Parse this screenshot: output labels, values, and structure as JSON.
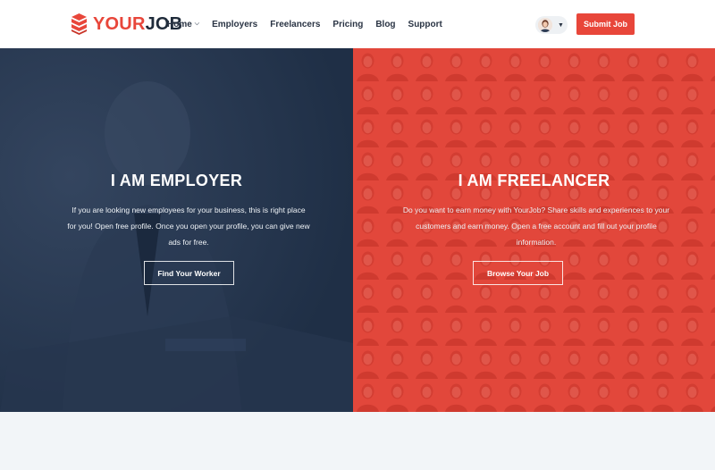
{
  "brand": {
    "part_a": "YOUR",
    "part_b": "JOB",
    "accent_color": "#e8463a",
    "dark_color": "#1f2b3a"
  },
  "nav": {
    "items": [
      {
        "label": "Home",
        "has_dropdown": true
      },
      {
        "label": "Employers"
      },
      {
        "label": "Freelancers"
      },
      {
        "label": "Pricing"
      },
      {
        "label": "Blog"
      },
      {
        "label": "Support"
      }
    ],
    "caret_icon": "chevron-down-icon"
  },
  "user_menu": {
    "avatar_icon": "user-avatar",
    "caret_icon": "caret-down-icon"
  },
  "header": {
    "submit_label": "Submit Job"
  },
  "employer": {
    "title": "I AM EMPLOYER",
    "text": "If you are looking new employees for your business, this is right place for you! Open free profile. Once you open your profile, you can give new ads for free.",
    "button_label": "Find Your Worker",
    "bg_color": "#1f2f46"
  },
  "freelancer": {
    "title": "I AM FREELANCER",
    "text": "Do you want to earn money with YourJob? Share skills and experiences to your customers and earn money. Open a free account and fill out your profile information.",
    "button_label": "Browse Your Job",
    "bg_color": "#e2473b"
  }
}
